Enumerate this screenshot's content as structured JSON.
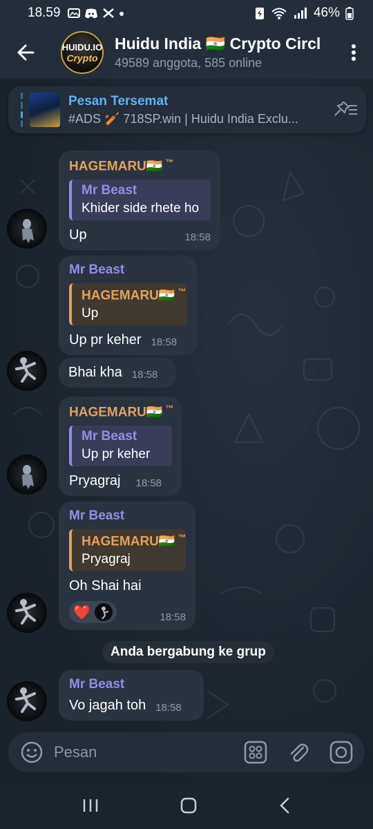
{
  "status_bar": {
    "time": "18.59",
    "battery": "46%"
  },
  "header": {
    "title": "Huidu India 🇮🇳 Crypto Circl",
    "subtitle": "49589 anggota, 585 online",
    "avatar_line1": "HUIDU.IO",
    "avatar_line2": "Crypto"
  },
  "pinned": {
    "title": "Pesan Tersemat",
    "body": "#ADS 🏏 718SP.win | Huidu India Exclu..."
  },
  "messages": [
    {
      "sender": "HAGEMARU🇮🇳",
      "reply_name": "Mr Beast",
      "reply_text": "Khider side rhete ho",
      "text": "Up",
      "time": "18:58"
    },
    {
      "sender": "Mr Beast",
      "reply_name": "HAGEMARU🇮🇳",
      "reply_text": "Up",
      "text": "Up pr keher",
      "time": "18:58"
    },
    {
      "text": "Bhai kha",
      "time": "18:58"
    },
    {
      "sender": "HAGEMARU🇮🇳",
      "reply_name": "Mr Beast",
      "reply_text": "Up pr keher",
      "text": "Pryagraj",
      "time": "18:58"
    },
    {
      "sender": "Mr Beast",
      "reply_name": "HAGEMARU🇮🇳",
      "reply_text": "Pryagraj",
      "text": "Oh Shai hai",
      "reaction": "❤️",
      "time": "18:58"
    },
    {
      "sender": "Mr Beast",
      "text": "Vo jagah toh",
      "time": "18:58"
    }
  ],
  "tm_mark": "™",
  "service_message": "Anda bergabung ke grup",
  "input": {
    "placeholder": "Pesan"
  }
}
